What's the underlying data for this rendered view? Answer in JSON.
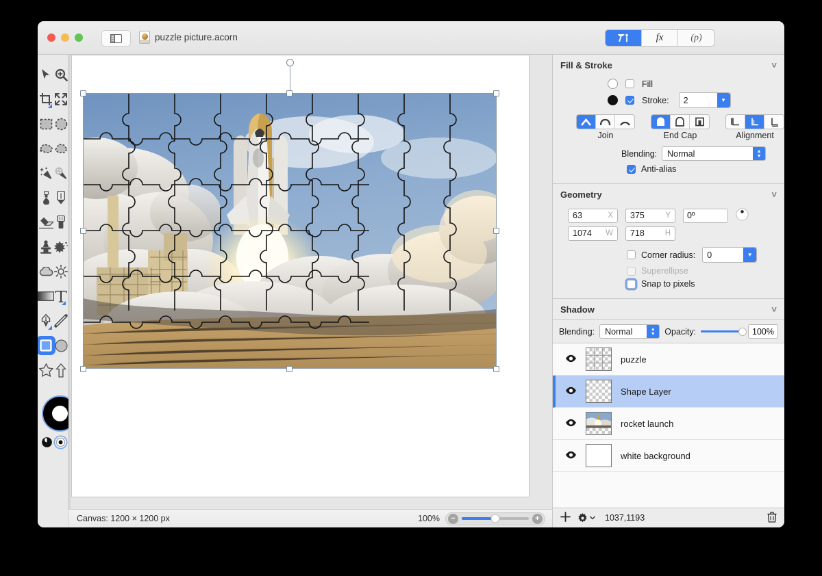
{
  "window": {
    "title": "puzzle picture.acorn",
    "doc_icon": "acorn-document-icon",
    "sidebar_toggle_icon": "sidebar-toggle-icon",
    "traffic_lights": [
      "close",
      "minimize",
      "zoom"
    ]
  },
  "inspector_tabs": [
    {
      "id": "tools",
      "label": "",
      "icon": "hammer-tool-icon",
      "active": true
    },
    {
      "id": "filters",
      "label": "fx",
      "icon": "fx-icon",
      "active": false
    },
    {
      "id": "palettes",
      "label": "(p)",
      "icon": "palette-icon",
      "active": false
    }
  ],
  "tools": [
    {
      "name": "move-tool",
      "icon": "arrow-cursor-icon",
      "selected": false
    },
    {
      "name": "zoom-tool",
      "icon": "magnifier-plus-icon",
      "selected": false
    },
    {
      "name": "crop-tool",
      "icon": "crop-icon",
      "selected": false,
      "badge": true
    },
    {
      "name": "transform-tool",
      "icon": "arrows-expand-icon",
      "selected": false
    },
    {
      "name": "rectangular-select-tool",
      "icon": "dashed-rectangle-icon",
      "selected": false
    },
    {
      "name": "elliptical-select-tool",
      "icon": "dashed-ellipse-icon",
      "selected": false
    },
    {
      "name": "lasso-tool",
      "icon": "dashed-lasso-icon",
      "selected": false
    },
    {
      "name": "polygonal-lasso-tool",
      "icon": "dashed-polygon-icon",
      "selected": false
    },
    {
      "name": "magic-wand-tool",
      "icon": "magic-wand-icon",
      "selected": false
    },
    {
      "name": "instant-alpha-tool",
      "icon": "instant-alpha-wand-icon",
      "selected": false
    },
    {
      "name": "paint-bucket-tool",
      "icon": "paint-bucket-icon",
      "selected": false
    },
    {
      "name": "pencil-tool",
      "icon": "pencil-icon",
      "selected": false
    },
    {
      "name": "eraser-tool",
      "icon": "eraser-icon",
      "selected": false
    },
    {
      "name": "marker-tool",
      "icon": "marker-icon",
      "selected": false
    },
    {
      "name": "clone-stamp-tool",
      "icon": "clone-stamp-icon",
      "selected": false
    },
    {
      "name": "smudge-tool",
      "icon": "smudge-splatter-icon",
      "selected": false
    },
    {
      "name": "blur-tool",
      "icon": "cloud-blur-icon",
      "selected": false
    },
    {
      "name": "sharpen-tool",
      "icon": "sun-sharpen-icon",
      "selected": false
    },
    {
      "name": "gradient-tool",
      "icon": "gradient-icon",
      "selected": false
    },
    {
      "name": "text-tool",
      "icon": "text-t-icon",
      "selected": false,
      "badge": true
    },
    {
      "name": "bezier-tool",
      "icon": "fountain-pen-icon",
      "selected": false,
      "badge": true
    },
    {
      "name": "line-tool",
      "icon": "line-icon",
      "selected": false
    },
    {
      "name": "rectangle-tool",
      "icon": "rectangle-shape-icon",
      "selected": true
    },
    {
      "name": "ellipse-tool",
      "icon": "ellipse-shape-icon",
      "selected": false
    },
    {
      "name": "star-tool",
      "icon": "star-shape-icon",
      "selected": false
    },
    {
      "name": "arrow-tool",
      "icon": "arrow-shape-icon",
      "selected": false
    }
  ],
  "color_well": {
    "stroke_color": "#000000",
    "fill_color": "#ffffff",
    "swap_icon": "swap-colors-icon",
    "reset_icon": "reset-colors-icon",
    "loupe_icon": "magnifier-icon"
  },
  "canvas": {
    "status_text": "Canvas: 1200 × 1200 px",
    "zoom_label": "100%",
    "zoom_out_icon": "minus-circle-icon",
    "zoom_in_icon": "plus-circle-icon",
    "zoom_slider_percent": 50,
    "artwork_alt": "jigsaw-puzzle-overlay-on-space-shuttle-launch"
  },
  "fill_stroke": {
    "title": "Fill & Stroke",
    "collapse_icon": "chevron-down-icon",
    "fill_label": "Fill",
    "fill_checked": false,
    "fill_swatch": "#ffffff",
    "stroke_label": "Stroke:",
    "stroke_checked": true,
    "stroke_swatch": "#000000",
    "stroke_width": "2",
    "join_label": "Join",
    "join_icons": [
      "miter-join-icon",
      "round-join-icon",
      "bevel-join-icon"
    ],
    "join_selected": 0,
    "endcap_label": "End Cap",
    "endcap_icons": [
      "round-cap-icon",
      "butt-cap-icon",
      "square-cap-icon"
    ],
    "endcap_selected": 0,
    "alignment_label": "Alignment",
    "alignment_icons": [
      "align-inside-icon",
      "align-center-icon",
      "align-outside-icon"
    ],
    "alignment_selected": 1,
    "blending_label": "Blending:",
    "blending_value": "Normal",
    "antialias_label": "Anti-alias",
    "antialias_checked": true
  },
  "geometry": {
    "title": "Geometry",
    "collapse_icon": "chevron-down-icon",
    "x_value": "63",
    "x_key": "X",
    "y_value": "375",
    "y_key": "Y",
    "rotation_value": "0º",
    "rotation_icon": "rotation-dial-icon",
    "w_value": "1074",
    "w_key": "W",
    "h_value": "718",
    "h_key": "H",
    "corner_radius_label": "Corner radius:",
    "corner_radius_checked": false,
    "corner_radius_value": "0",
    "superellipse_label": "Superellipse",
    "superellipse_checked": false,
    "superellipse_disabled": true,
    "snap_label": "Snap to pixels",
    "snap_checked": false,
    "snap_focused": true
  },
  "shadow": {
    "title": "Shadow",
    "collapse_icon": "chevron-down-icon"
  },
  "layers_panel": {
    "blending_label": "Blending:",
    "blending_value": "Normal",
    "opacity_label": "Opacity:",
    "opacity_value": "100%",
    "opacity_percent": 100,
    "add_icon": "plus-icon",
    "settings_icon": "gear-icon",
    "settings_chevron_icon": "chevron-down-icon",
    "coords": "1037,1193",
    "delete_icon": "trash-icon",
    "eye_icon": "eye-visibility-icon",
    "layers": [
      {
        "name": "puzzle",
        "visible": true,
        "selected": false,
        "thumb": "transparent-puzzle-thumb"
      },
      {
        "name": "Shape Layer",
        "visible": true,
        "selected": true,
        "thumb": "transparent-empty-thumb"
      },
      {
        "name": "rocket launch",
        "visible": true,
        "selected": false,
        "thumb": "rocket-launch-photo-thumb"
      },
      {
        "name": "white background",
        "visible": true,
        "selected": false,
        "thumb": "white-thumb"
      }
    ]
  },
  "colors": {
    "accent": "#3b7ef0",
    "selection": "#b6cdf5",
    "window_bg": "#ececec",
    "canvas_bg": "#e6e6e6"
  }
}
